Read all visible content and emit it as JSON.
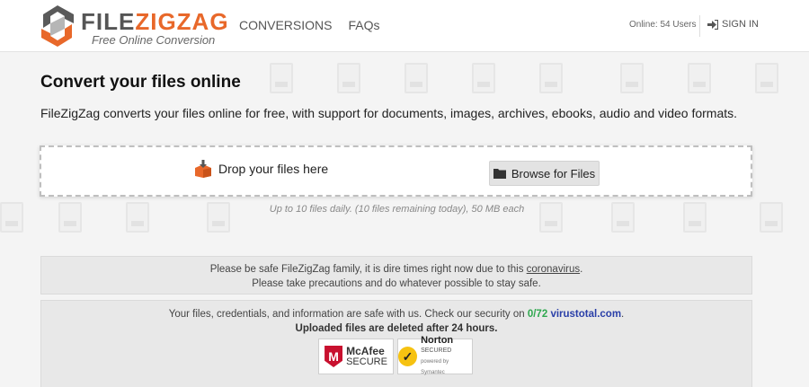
{
  "header": {
    "logo_prefix": "FILE",
    "logo_suffix": "ZIGZAG",
    "logo_subtitle": "Free Online Conversion",
    "nav": [
      {
        "label": "CONVERSIONS"
      },
      {
        "label": "FAQs"
      }
    ],
    "online_status": "Online: 54 Users",
    "signin_label": "SIGN IN"
  },
  "main": {
    "title": "Convert your files online",
    "intro": "FileZigZag converts your files online for free, with support for documents, images, archives, ebooks, audio and video formats.",
    "dropzone": {
      "drop_label": "Drop your files here",
      "browse_label": "Browse for Files"
    },
    "limits": "Up to 10 files daily. (10 files remaining today), 50 MB each"
  },
  "notice": {
    "line1_prefix": "Please be safe FileZigZag family, it is dire times right now due to this ",
    "line1_link": "coronavirus",
    "line1_suffix": ".",
    "line2": "Please take precautions and do whatever possible to stay safe."
  },
  "security": {
    "line1_prefix": "Your files, credentials, and information are safe with us. Check our security on ",
    "score": "0/72",
    "vt_link": "virustotal.com",
    "line1_suffix": ".",
    "line2": "Uploaded files are deleted after 24 hours.",
    "badges": {
      "mcafee_line1": "McAfee",
      "mcafee_line2": "SECURE",
      "norton_line1": "Norton",
      "norton_line2": "SECURED",
      "norton_line3": "powered by Symantec"
    }
  },
  "colors": {
    "accent": "#e8682a",
    "score_green": "#2fa84f",
    "link_blue": "#2a3fa8"
  }
}
